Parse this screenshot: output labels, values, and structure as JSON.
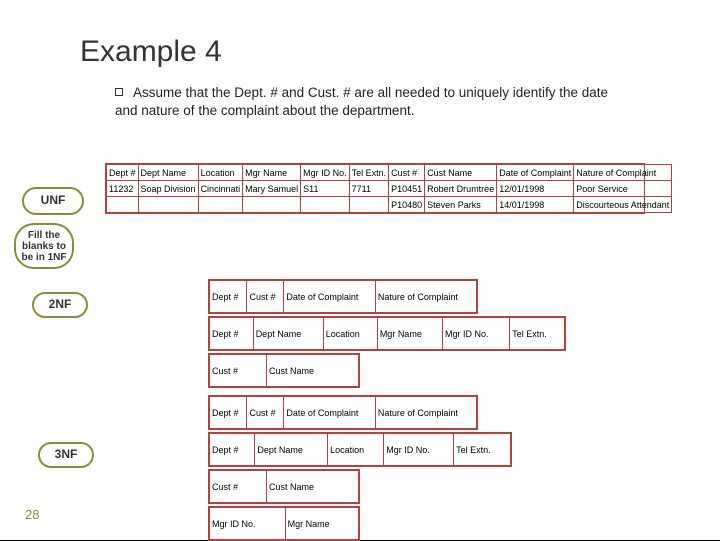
{
  "title": "Example 4",
  "bullet": "Assume that the Dept. # and Cust. # are all needed to uniquely identify the date and nature of the complaint about the department.",
  "labels": {
    "unf": "UNF",
    "fill": "Fill the blanks to be in 1NF",
    "nf2": "2NF",
    "nf3": "3NF"
  },
  "pagenum": "28",
  "unf": {
    "headers": [
      "Dept #",
      "Dept Name",
      "Location",
      "Mgr Name",
      "Mgr ID No.",
      "Tel Extn.",
      "Cust #",
      "Cust Name",
      "Date of Complaint",
      "Nature of Complaint"
    ],
    "rows": [
      [
        "11232",
        "Soap Division",
        "Cincinnati",
        "Mary Samuel",
        "S11",
        "7711",
        "P10451",
        "Robert Drumtree",
        "12/01/1998",
        "Poor Service"
      ],
      [
        "",
        "",
        "",
        "",
        "",
        "",
        "P10480",
        "Steven Parks",
        "14/01/1998",
        "Discourteous Attendant"
      ]
    ]
  },
  "nf2": {
    "t1": [
      "Dept #",
      "Cust #",
      "Date of Complaint",
      "Nature of Complaint"
    ],
    "t2": [
      "Dept #",
      "Dept Name",
      "Location",
      "Mgr Name",
      "Mgr ID No.",
      "Tel Extn."
    ],
    "t3": [
      "Cust #",
      "Cust Name"
    ]
  },
  "nf3": {
    "t1": [
      "Dept #",
      "Cust #",
      "Date of Complaint",
      "Nature of Complaint"
    ],
    "t2": [
      "Dept #",
      "Dept Name",
      "Location",
      "Mgr ID No.",
      "Tel Extn."
    ],
    "t3": [
      "Cust #",
      "Cust Name"
    ],
    "t4": [
      "Mgr ID No.",
      "Mgr Name"
    ]
  }
}
